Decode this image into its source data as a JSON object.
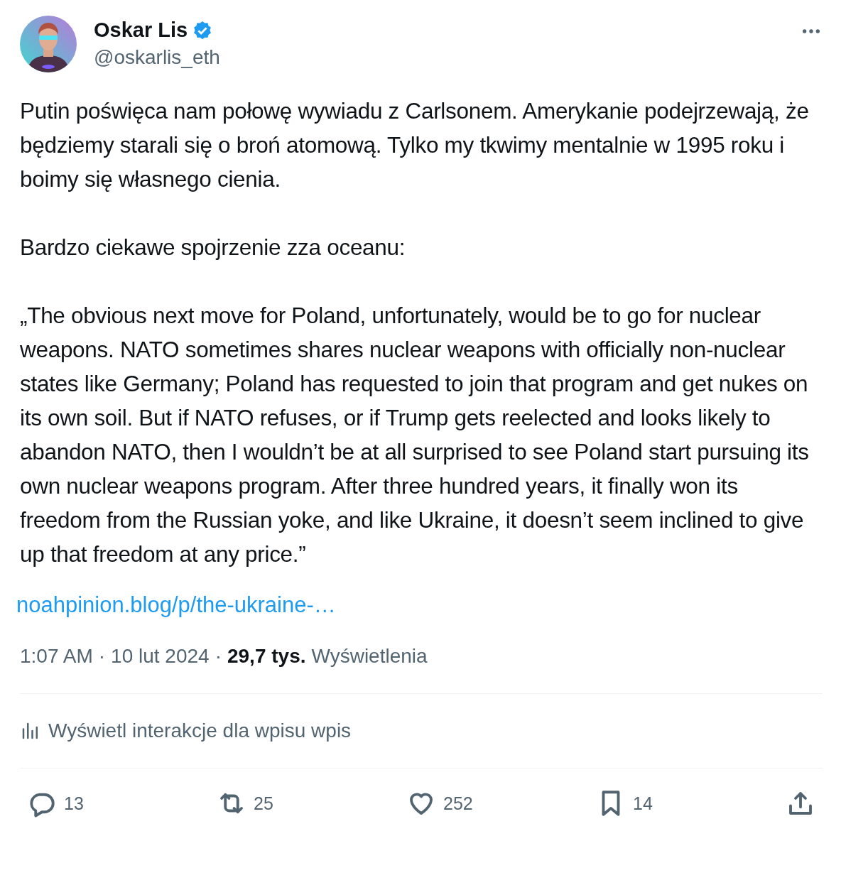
{
  "author": {
    "name": "Oskar Lis",
    "handle": "@oskarlis_eth",
    "verified": true
  },
  "paragraphs": [
    "Putin poświęca nam połowę wywiadu z Carlsonem. Amerykanie podejrzewają, że będziemy starali się o broń atomową. Tylko my tkwimy mentalnie w 1995 roku i boimy się własnego cienia.",
    "Bardzo ciekawe spojrzenie zza oceanu:",
    "„The obvious next move for Poland, unfortunately, would be to go for nuclear weapons. NATO sometimes shares nuclear weapons with officially non-nuclear states like Germany; Poland has requested to join that program and get nukes on its own soil. But if NATO refuses, or if Trump gets reelected and looks likely to abandon NATO, then I wouldn’t be at all surprised to see Poland start pursuing its own nuclear weapons program. After three hundred years, it finally won its freedom from the Russian yoke, and like Ukraine, it doesn’t seem inclined to give up that freedom at any price.”"
  ],
  "link": "noahpinion.blog/p/the-ukraine-…",
  "meta": {
    "time": "1:07 AM",
    "separator": "·",
    "date": "10 lut 2024",
    "views_count": "29,7 tys.",
    "views_label": "Wyświetlenia"
  },
  "analytics_link": "Wyświetl interakcje dla wpisu wpis",
  "actions": [
    {
      "kind": "reply",
      "count": "13"
    },
    {
      "kind": "repost",
      "count": "25"
    },
    {
      "kind": "like",
      "count": "252"
    },
    {
      "kind": "bookmark",
      "count": "14"
    },
    {
      "kind": "share"
    }
  ]
}
